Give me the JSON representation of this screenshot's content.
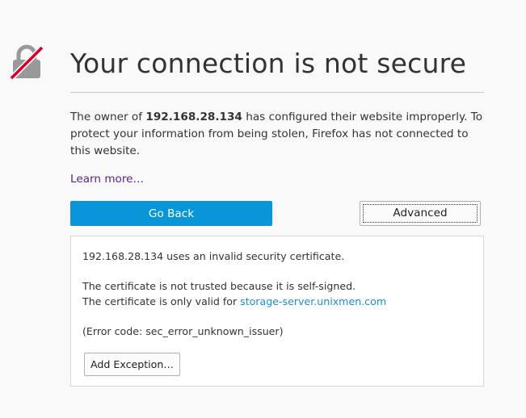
{
  "page": {
    "title": "Your connection is not secure",
    "description_prefix": "The owner of ",
    "host": "192.168.28.134",
    "description_suffix": " has configured their website improperly. To protect your information from being stolen, Firefox has not connected to this website.",
    "learn_more": "Learn more…"
  },
  "buttons": {
    "go_back": "Go Back",
    "advanced": "Advanced",
    "add_exception": "Add Exception…"
  },
  "advanced_panel": {
    "line1": "192.168.28.134 uses an invalid security certificate.",
    "line2": "The certificate is not trusted because it is self-signed.",
    "line3_prefix": "The certificate is only valid for ",
    "line3_link": "storage-server.unixmen.com",
    "error_code": "(Error code: sec_error_unknown_issuer)"
  },
  "icons": {
    "lock": "broken-lock-icon"
  },
  "colors": {
    "primary_button": "#0996d9",
    "link_visited": "#5d2290",
    "link": "#1a8ed0",
    "lock_strike": "#d70022",
    "lock_body": "#999999"
  }
}
